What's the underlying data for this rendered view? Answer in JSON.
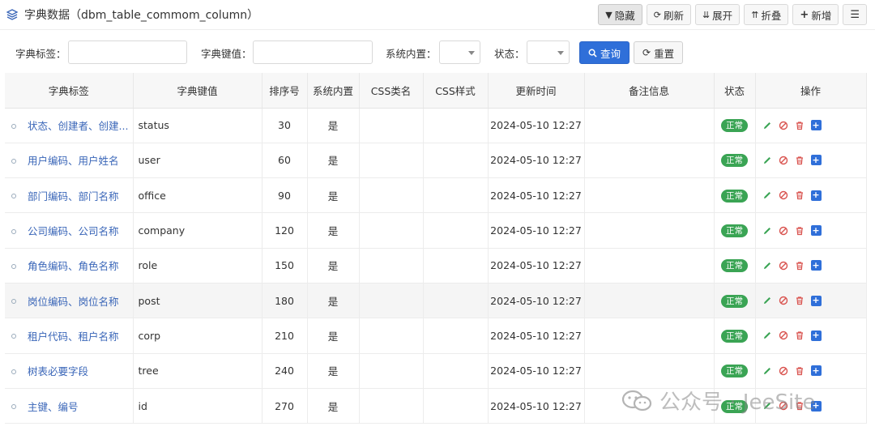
{
  "header": {
    "title": "字典数据（dbm_table_commom_column）",
    "toolbar": [
      {
        "label": "隐藏",
        "icon": "filter-icon"
      },
      {
        "label": "刷新",
        "icon": "refresh-icon"
      },
      {
        "label": "展开",
        "icon": "expand-icon"
      },
      {
        "label": "折叠",
        "icon": "collapse-icon"
      },
      {
        "label": "新增",
        "icon": "plus-icon"
      },
      {
        "label": "",
        "icon": "menu-icon"
      }
    ]
  },
  "search": {
    "label_field": "字典标签：",
    "value_field": "字典键值：",
    "system_field": "系统内置：",
    "status_field": "状态：",
    "query_button": "查询",
    "reset_button": "重置"
  },
  "table": {
    "columns": [
      "字典标签",
      "字典键值",
      "排序号",
      "系统内置",
      "CSS类名",
      "CSS样式",
      "更新时间",
      "备注信息",
      "状态",
      "操作"
    ],
    "rows": [
      {
        "label": "状态、创建者、创建...",
        "value": "status",
        "sort": "30",
        "system": "是",
        "css_class": "",
        "css_style": "",
        "updated": "2024-05-10 12:27",
        "remark": "",
        "status": "正常"
      },
      {
        "label": "用户编码、用户姓名",
        "value": "user",
        "sort": "60",
        "system": "是",
        "css_class": "",
        "css_style": "",
        "updated": "2024-05-10 12:27",
        "remark": "",
        "status": "正常"
      },
      {
        "label": "部门编码、部门名称",
        "value": "office",
        "sort": "90",
        "system": "是",
        "css_class": "",
        "css_style": "",
        "updated": "2024-05-10 12:27",
        "remark": "",
        "status": "正常"
      },
      {
        "label": "公司编码、公司名称",
        "value": "company",
        "sort": "120",
        "system": "是",
        "css_class": "",
        "css_style": "",
        "updated": "2024-05-10 12:27",
        "remark": "",
        "status": "正常"
      },
      {
        "label": "角色编码、角色名称",
        "value": "role",
        "sort": "150",
        "system": "是",
        "css_class": "",
        "css_style": "",
        "updated": "2024-05-10 12:27",
        "remark": "",
        "status": "正常"
      },
      {
        "label": "岗位编码、岗位名称",
        "value": "post",
        "sort": "180",
        "system": "是",
        "css_class": "",
        "css_style": "",
        "updated": "2024-05-10 12:27",
        "remark": "",
        "status": "正常"
      },
      {
        "label": "租户代码、租户名称",
        "value": "corp",
        "sort": "210",
        "system": "是",
        "css_class": "",
        "css_style": "",
        "updated": "2024-05-10 12:27",
        "remark": "",
        "status": "正常"
      },
      {
        "label": "树表必要字段",
        "value": "tree",
        "sort": "240",
        "system": "是",
        "css_class": "",
        "css_style": "",
        "updated": "2024-05-10 12:27",
        "remark": "",
        "status": "正常"
      },
      {
        "label": "主键、编号",
        "value": "id",
        "sort": "270",
        "system": "是",
        "css_class": "",
        "css_style": "",
        "updated": "2024-05-10 12:27",
        "remark": "",
        "status": "正常"
      }
    ]
  },
  "watermark": "公众号 · JeeSite",
  "colors": {
    "primary": "#2f6fd9",
    "status_ok": "#3aa454",
    "link": "#3a66b8"
  }
}
